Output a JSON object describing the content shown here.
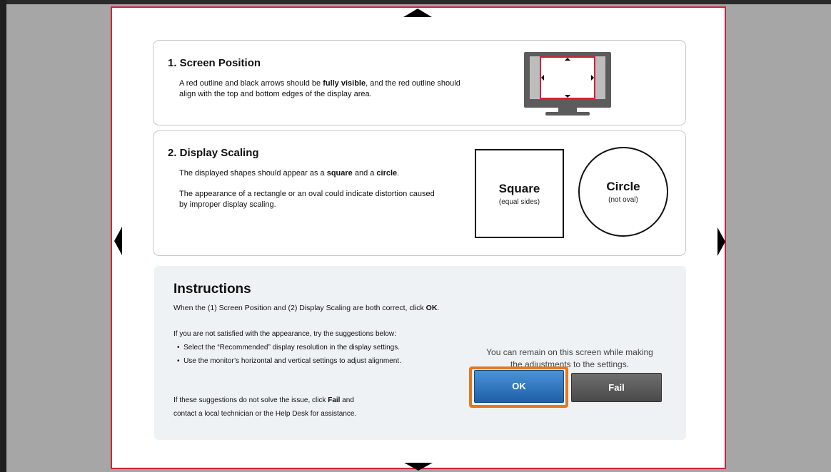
{
  "section1": {
    "title": "1. Screen Position",
    "text_part1": "A red outline and black arrows should be ",
    "text_bold": "fully visible",
    "text_part2": ", and the red outline should align with the top and bottom edges of the display area."
  },
  "section2": {
    "title": "2. Display Scaling",
    "line1_part1": "The displayed shapes should appear as a ",
    "line1_bold1": "square",
    "line1_part2": " and a ",
    "line1_bold2": "circle",
    "line1_part3": ".",
    "line2": "The appearance of a rectangle or an oval could indicate distortion caused by improper display scaling.",
    "square_label": "Square",
    "square_sub": "(equal sides)",
    "circle_label": "Circle",
    "circle_sub": "(not oval)"
  },
  "instructions": {
    "title": "Instructions",
    "line1_part1": "When the (1) Screen Position and (2) Display Scaling are both correct, click ",
    "line1_bold": "OK",
    "line1_part2": ".",
    "line2": "If you are not satisfied with the appearance, try the suggestions below:",
    "bullets": [
      "Select the “Recommended” display resolution in the display settings.",
      "Use the monitor’s horizontal and vertical settings to adjust alignment."
    ],
    "line3_part1": "If these suggestions do not solve the issue, click ",
    "line3_bold": "Fail",
    "line3_part2": " and",
    "line4": "contact a local technician or the Help Desk for assistance."
  },
  "note": "You can remain on this screen while making the adjustments to the settings.",
  "buttons": {
    "ok": "OK",
    "fail": "Fail"
  },
  "colors": {
    "outline": "#d0233c",
    "ok_blue": "#2a6cb8",
    "highlight": "#e6771f"
  }
}
